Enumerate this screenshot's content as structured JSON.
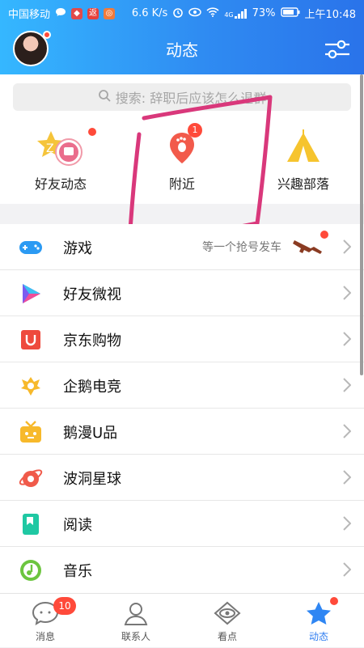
{
  "status_bar": {
    "carrier": "中国移动",
    "speed": "6.6 K/s",
    "signal_label": "4G",
    "battery": "73%",
    "time": "上午10:48",
    "mini_icon_return": "返"
  },
  "header": {
    "title": "动态"
  },
  "search": {
    "placeholder": "搜索: 辞职后应该怎么退群"
  },
  "quick_entries": [
    {
      "label": "好友动态",
      "icon": "friends-feed-icon"
    },
    {
      "label": "附近",
      "icon": "nearby-footprint-icon",
      "badge": "1"
    },
    {
      "label": "兴趣部落",
      "icon": "tribe-tent-icon"
    }
  ],
  "list_items": [
    {
      "label": "游戏",
      "icon": "gamepad-icon",
      "hint": "等一个抢号发车"
    },
    {
      "label": "好友微视",
      "icon": "weishi-icon"
    },
    {
      "label": "京东购物",
      "icon": "jd-shopping-icon"
    },
    {
      "label": "企鹅电竞",
      "icon": "esports-icon"
    },
    {
      "label": "鹅漫U品",
      "icon": "tv-box-icon"
    },
    {
      "label": "波洞星球",
      "icon": "planet-icon"
    },
    {
      "label": "阅读",
      "icon": "bookmark-icon"
    },
    {
      "label": "音乐",
      "icon": "music-icon"
    }
  ],
  "tabs": [
    {
      "label": "消息",
      "badge": "10"
    },
    {
      "label": "联系人"
    },
    {
      "label": "看点"
    },
    {
      "label": "动态",
      "active": true
    }
  ],
  "colors": {
    "accent": "#2f7df0",
    "badge": "#ff4a3a",
    "annotation": "#d9387b"
  }
}
